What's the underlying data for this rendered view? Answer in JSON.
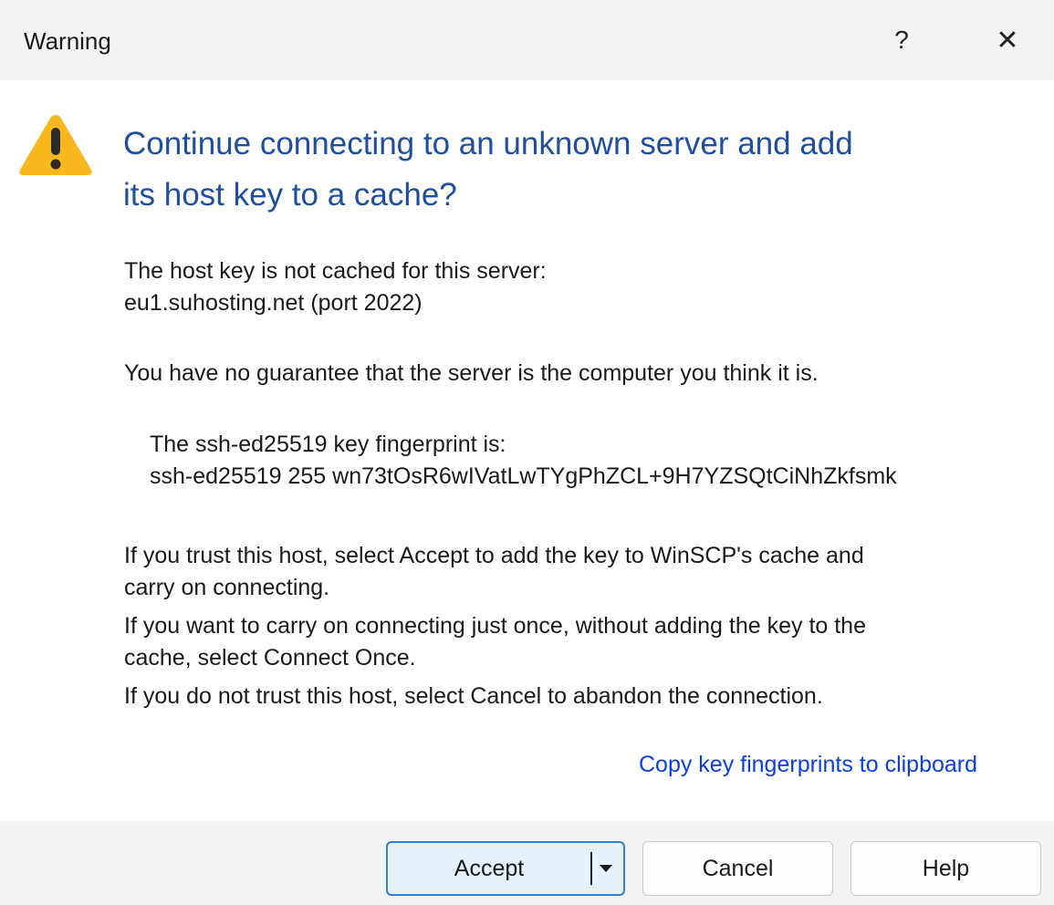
{
  "window": {
    "title": "Warning",
    "help_glyph": "?",
    "close_glyph": "✕"
  },
  "icon": {
    "name": "warning-icon",
    "color": "#f9b81d"
  },
  "heading": {
    "line1": "Continue connecting to an unknown server and add",
    "line2": "its host key to a cache?"
  },
  "message": {
    "not_cached": "The host key is not cached for this server:",
    "server": "eu1.suhosting.net (port 2022)",
    "no_guarantee": "You have no guarantee that the server is the computer you think it is.",
    "fingerprint_label": "The ssh-ed25519 key fingerprint is:",
    "fingerprint": "ssh-ed25519 255 wn73tOsR6wIVatLwTYgPhZCL+9H7YZSQtCiNhZkfsmk",
    "trust_line1": "If you trust this host, select Accept to add the key to WinSCP's cache and",
    "trust_line2": "carry on connecting.",
    "once_line1": "If you want to carry on connecting just once, without adding the key to the",
    "once_line2": "cache, select Connect Once.",
    "cancel_line": "If you do not trust this host, select Cancel to abandon the connection."
  },
  "link": {
    "copy_fingerprints": "Copy key fingerprints to clipboard"
  },
  "buttons": {
    "accept": "Accept",
    "cancel": "Cancel",
    "help": "Help"
  },
  "colors": {
    "heading": "#1f4e9f",
    "link": "#0b3fe0",
    "accept_border": "#3a7fd0",
    "accept_bg": "#e5f1fb",
    "chrome_bg": "#f3f3f3"
  }
}
